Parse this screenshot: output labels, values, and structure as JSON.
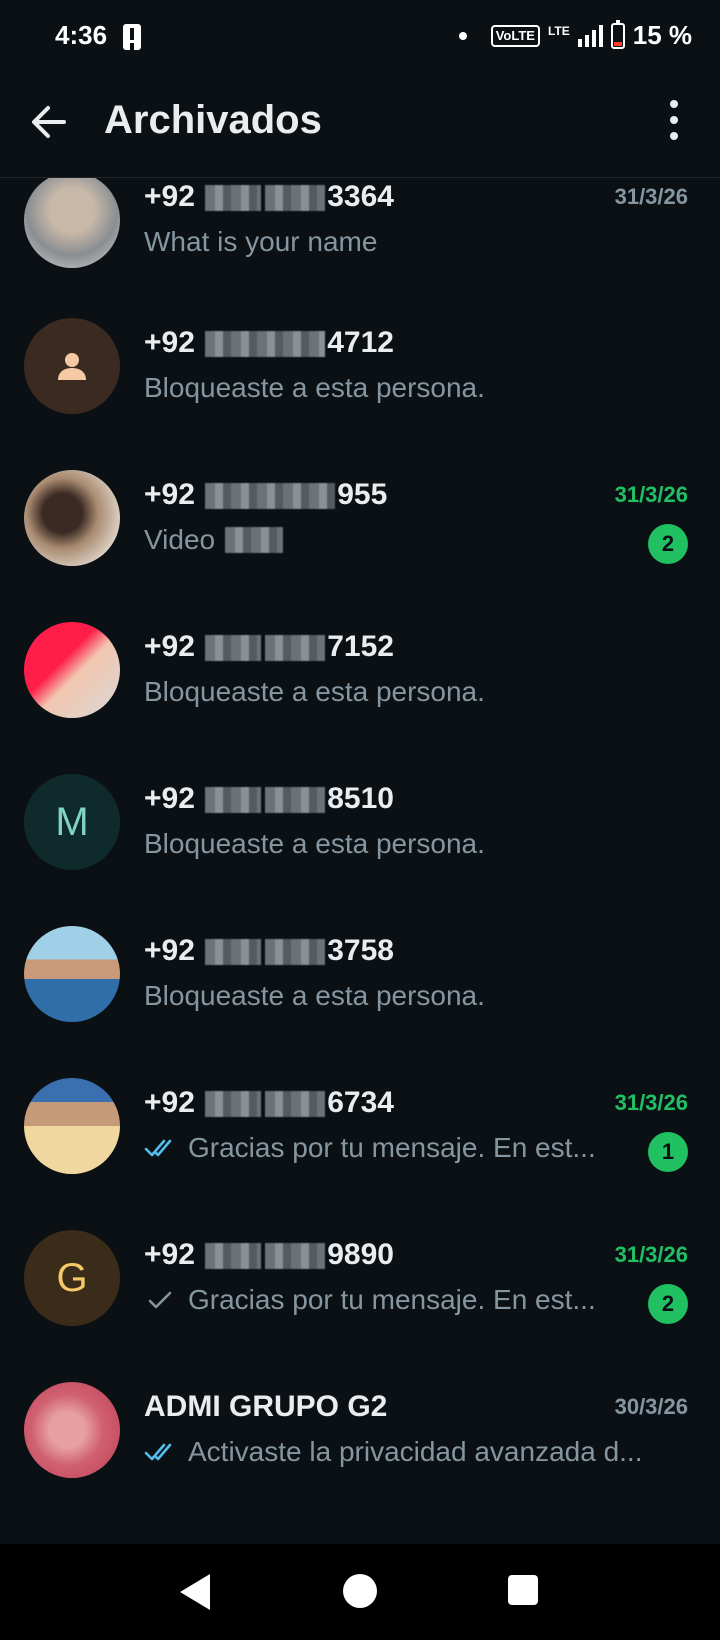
{
  "status": {
    "time": "4:36",
    "volte": "VoLTE",
    "lte": "LTE",
    "battery": "15 %"
  },
  "header": {
    "title": "Archivados"
  },
  "chats": [
    {
      "name_prefix": "+92",
      "name_suffix": "3364",
      "preview": "What is your name",
      "time": "31/3/26",
      "time_color": "gray",
      "badge": null,
      "tick": null
    },
    {
      "name_prefix": "+92",
      "name_suffix": "4712",
      "preview": "Bloqueaste a esta persona.",
      "time": "",
      "time_color": "gray",
      "badge": null,
      "tick": null
    },
    {
      "name_prefix": "+92",
      "name_suffix": "955",
      "preview": "Video",
      "time": "31/3/26",
      "time_color": "green",
      "badge": "2",
      "tick": null
    },
    {
      "name_prefix": "+92",
      "name_suffix": "7152",
      "preview": "Bloqueaste a esta persona.",
      "time": "",
      "time_color": "gray",
      "badge": null,
      "tick": null
    },
    {
      "name_prefix": "+92",
      "name_suffix": "8510",
      "preview": "Bloqueaste a esta persona.",
      "time": "",
      "time_color": "gray",
      "badge": null,
      "tick": null,
      "avatar_letter": "M"
    },
    {
      "name_prefix": "+92",
      "name_suffix": "3758",
      "preview": "Bloqueaste a esta persona.",
      "time": "",
      "time_color": "gray",
      "badge": null,
      "tick": null
    },
    {
      "name_prefix": "+92",
      "name_suffix": "6734",
      "preview": "Gracias por tu mensaje. En est...",
      "time": "31/3/26",
      "time_color": "green",
      "badge": "1",
      "tick": "double-blue"
    },
    {
      "name_prefix": "+92",
      "name_suffix": "9890",
      "preview": "Gracias por tu mensaje. En est...",
      "time": "31/3/26",
      "time_color": "green",
      "badge": "2",
      "tick": "single-gray",
      "avatar_letter": "G"
    },
    {
      "name_prefix": "",
      "name": "ADMI GRUPO G2",
      "preview": "Activaste la privacidad avanzada d...",
      "time": "30/3/26",
      "time_color": "gray",
      "badge": null,
      "tick": "double-blue"
    }
  ],
  "colors": {
    "background": "#0b1014",
    "accent_green": "#21c063",
    "text_primary": "#e9edef",
    "text_secondary": "#8696a0",
    "tick_blue": "#53bdeb"
  }
}
